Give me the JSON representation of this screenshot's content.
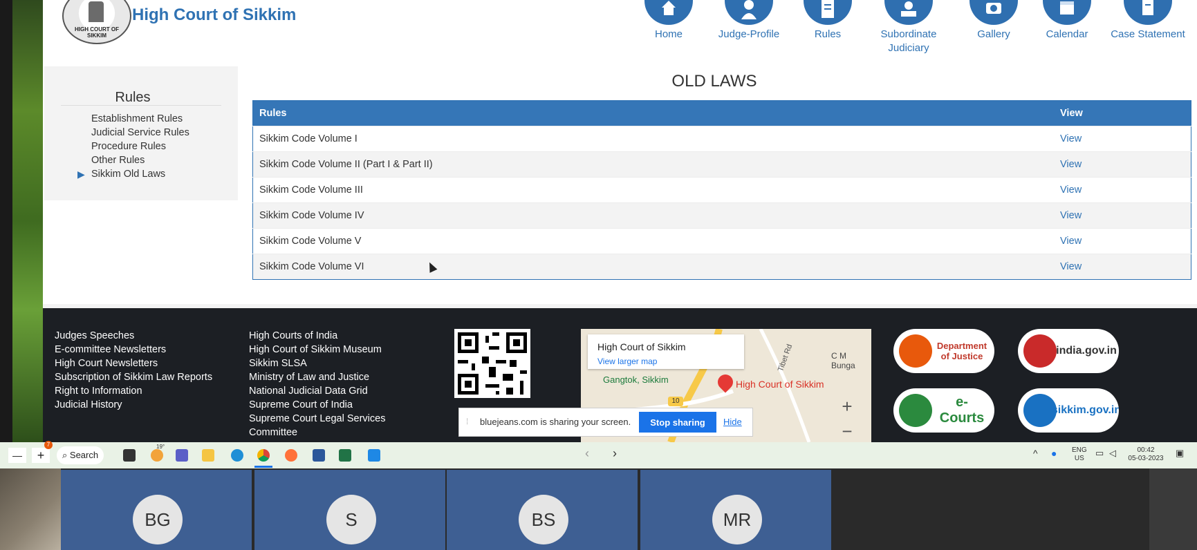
{
  "site": {
    "title": "High Court of Sikkim",
    "logo_text": "HIGH COURT OF SIKKIM",
    "nav": [
      {
        "label": "Home",
        "icon": "home-icon"
      },
      {
        "label": "Judge-Profile",
        "icon": "judge-icon"
      },
      {
        "label": "Rules",
        "icon": "rules-icon"
      },
      {
        "label": "Subordinate Judiciary",
        "icon": "court-icon"
      },
      {
        "label": "Gallery",
        "icon": "camera-icon"
      },
      {
        "label": "Calendar",
        "icon": "calendar-icon"
      },
      {
        "label": "Case Statement",
        "icon": "document-icon"
      }
    ]
  },
  "sidebar": {
    "heading": "Rules",
    "items": [
      {
        "label": "Establishment Rules"
      },
      {
        "label": "Judicial Service Rules"
      },
      {
        "label": "Procedure Rules"
      },
      {
        "label": "Other Rules"
      },
      {
        "label": "Sikkim Old Laws",
        "active": true
      }
    ]
  },
  "main": {
    "heading": "OLD LAWS",
    "table": {
      "headers": [
        "Rules",
        "View"
      ],
      "rows": [
        {
          "name": "Sikkim Code Volume I",
          "view": "View"
        },
        {
          "name": "Sikkim Code Volume II (Part I & Part II)",
          "view": "View"
        },
        {
          "name": "Sikkim Code Volume III",
          "view": "View"
        },
        {
          "name": "Sikkim Code Volume IV",
          "view": "View"
        },
        {
          "name": "Sikkim Code Volume V",
          "view": "View"
        },
        {
          "name": "Sikkim Code Volume VI",
          "view": "View"
        }
      ]
    }
  },
  "footer": {
    "col1": [
      "Judges Speeches",
      "E-committee Newsletters",
      "High Court Newsletters",
      "Subscription of Sikkim Law Reports",
      "Right to Information",
      "Judicial History"
    ],
    "col2": [
      "High Courts of India",
      "High Court of Sikkim Museum",
      "Sikkim SLSA",
      "Ministry of Law and Justice",
      "National Judicial Data Grid",
      "Supreme Court of India",
      "Supreme Court Legal Services",
      "Committee"
    ],
    "map": {
      "card_title": "High Court of Sikkim",
      "card_link": "View larger map",
      "place_label": "High Court of Sikkim",
      "city_label": "Gangtok, Sikkim",
      "road_label": "Tibet Rd",
      "area_label": "C M Bunga",
      "road_number": "10",
      "zoom_in": "+",
      "zoom_out": "−"
    },
    "badges": [
      {
        "text": "Department of Justice",
        "color": "#e8590c"
      },
      {
        "text": "india.gov.in",
        "color": "#c92a2a"
      },
      {
        "text": "e-Courts",
        "color": "#2b8a3e"
      },
      {
        "text": "sikkim.gov.in",
        "color": "#1971c2"
      }
    ]
  },
  "share_bar": {
    "message": "bluejeans.com is sharing your screen.",
    "stop_label": "Stop sharing",
    "hide_label": "Hide"
  },
  "taskbar": {
    "search_label": "Search",
    "weather": "19°",
    "badge_count": "7",
    "lang_top": "ENG",
    "lang_bottom": "US",
    "time": "00:42",
    "date": "05-03-2023"
  },
  "participants": [
    {
      "initials": "BG"
    },
    {
      "initials": "S"
    },
    {
      "initials": "BS"
    },
    {
      "initials": "MR"
    }
  ]
}
